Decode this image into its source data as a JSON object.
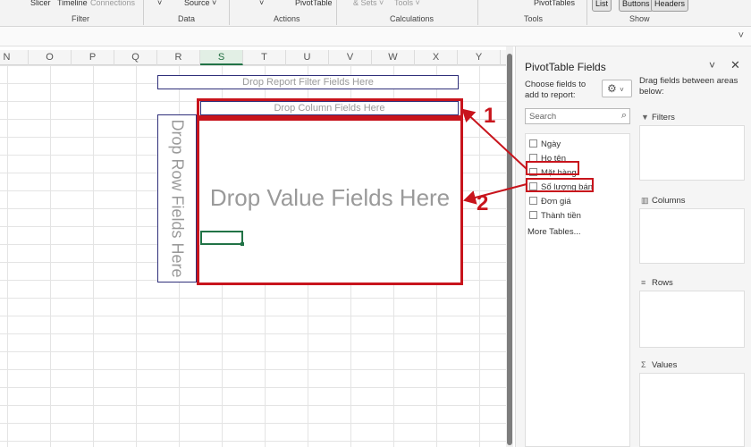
{
  "ribbon": {
    "items": {
      "slicer": "Slicer",
      "timeline": "Timeline",
      "connections": "Connections",
      "source": "Source ˅",
      "pivottable": "PivotTable",
      "sets": "& Sets ˅",
      "tools": "Tools ˅",
      "pivottables": "PivotTables",
      "list": "List",
      "buttons": "Buttons",
      "headers": "Headers"
    },
    "groups": {
      "filter": "Filter",
      "data": "Data",
      "actions": "Actions",
      "calculations": "Calculations",
      "tools": "Tools",
      "show": "Show"
    }
  },
  "sheet": {
    "columns": [
      "N",
      "O",
      "P",
      "Q",
      "R",
      "S",
      "T",
      "U",
      "V",
      "W",
      "X",
      "Y"
    ],
    "selected_column": "S",
    "drop_report_filter": "Drop Report Filter Fields Here",
    "drop_column": "Drop Column Fields Here",
    "drop_row": "Drop Row Fields Here",
    "drop_value": "Drop Value Fields Here"
  },
  "annotations": {
    "label_1": "1",
    "label_2": "2",
    "color": "#c8141c"
  },
  "pane": {
    "title": "PivotTable Fields",
    "choose_fields": "Choose fields to add to report:",
    "drag_fields": "Drag fields between areas below:",
    "search_placeholder": "Search",
    "fields": [
      "Ngày",
      "Họ tên",
      "Mặt hàng",
      "Số lượng bán",
      "Đơn giá",
      "Thành tiền"
    ],
    "more_tables": "More Tables...",
    "areas": {
      "filters": "Filters",
      "columns": "Columns",
      "rows": "Rows",
      "values": "Values"
    }
  }
}
